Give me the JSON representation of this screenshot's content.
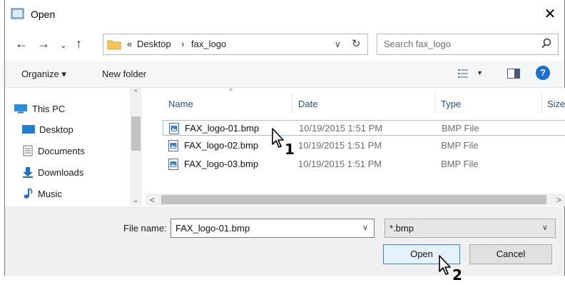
{
  "window": {
    "title": "Open"
  },
  "address": {
    "overflow": "«",
    "crumbs": [
      "Desktop",
      "fax_logo"
    ],
    "separator": "›"
  },
  "search": {
    "placeholder": "Search fax_logo"
  },
  "toolbar": {
    "organize": "Organize ▾",
    "new_folder": "New folder",
    "help": "?"
  },
  "nav": {
    "items": [
      {
        "label": "This PC",
        "icon": "computer-icon"
      },
      {
        "label": "Desktop",
        "icon": "desktop-icon"
      },
      {
        "label": "Documents",
        "icon": "documents-icon"
      },
      {
        "label": "Downloads",
        "icon": "downloads-icon"
      },
      {
        "label": "Music",
        "icon": "music-icon"
      }
    ]
  },
  "filelist": {
    "columns": [
      "Name",
      "Date",
      "Type",
      "Size"
    ],
    "rows": [
      {
        "name": "FAX_logo-01.bmp",
        "date": "10/19/2015 1:51 PM",
        "type": "BMP File",
        "selected": true
      },
      {
        "name": "FAX_logo-02.bmp",
        "date": "10/19/2015 1:51 PM",
        "type": "BMP File",
        "selected": false
      },
      {
        "name": "FAX_logo-03.bmp",
        "date": "10/19/2015 1:51 PM",
        "type": "BMP File",
        "selected": false
      }
    ]
  },
  "bottom": {
    "file_name_label": "File name:",
    "file_name_value": "FAX_logo-01.bmp",
    "file_type_value": "*.bmp",
    "open_label": "Open",
    "cancel_label": "Cancel"
  },
  "annotations": {
    "step1": "1",
    "step2": "2"
  },
  "colors": {
    "accent": "#1a6fcf",
    "selection_border": "#9fc2ea",
    "header_text": "#2b4c7e"
  }
}
